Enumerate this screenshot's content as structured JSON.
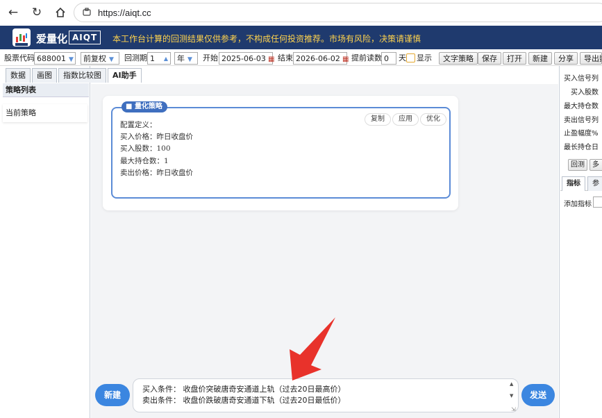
{
  "browser": {
    "url": "https://aiqt.cc"
  },
  "app": {
    "name": "爱量化",
    "badge": "AIQT",
    "disclaimer": "本工作台计算的回测结果仅供参考，不构成任何投资推荐。市场有风险，决策请谨慎"
  },
  "toolbar": {
    "stock_label": "股票代码",
    "stock_value": "688001",
    "adjust_value": "前复权",
    "period_label": "回测期",
    "period_value": "1",
    "period_unit": "年",
    "start_label": "开始",
    "start_value": "2025-06-03",
    "end_label": "结束",
    "end_value": "2026-06-02",
    "preread_label": "提前读数",
    "preread_value": "0",
    "preread_unit": "天",
    "show_label": "显示",
    "text_strategy_btn": "文字策略",
    "save_btn": "保存",
    "open_btn": "打开",
    "new_btn": "新建",
    "share_btn": "分享",
    "export_btn": "导出数"
  },
  "left": {
    "tabs": [
      "数据",
      "画图",
      "指数比较图",
      "AI助手"
    ],
    "strategy_header": "策略列表",
    "current_strategy": "当前策略"
  },
  "strategy_card": {
    "tag": "量化策略",
    "copy_btn": "复制",
    "apply_btn": "应用",
    "optimize_btn": "优化",
    "lines": [
      "配置定义：",
      "买入价格：昨日收盘价",
      "买入股数：100",
      "最大持仓数：1",
      "卖出价格：昨日收盘价"
    ]
  },
  "input": {
    "new_btn": "新建",
    "line1": "买入条件：  收盘价突破唐奇安通道上轨（过去20日最高价）",
    "line2": "卖出条件：  收盘价跌破唐奇安通道下轨（过去20日最低价）",
    "send_btn": "发送"
  },
  "right": {
    "labels": [
      "买入信号列",
      "买入股数",
      "最大持仓数",
      "卖出信号列",
      "止盈幅度%",
      "最长持仓日"
    ],
    "backtest_btn": "回测",
    "multi_btn": "多是",
    "tab_indicator": "指标",
    "tab_params": "参",
    "add_indicator": "添加指标"
  }
}
